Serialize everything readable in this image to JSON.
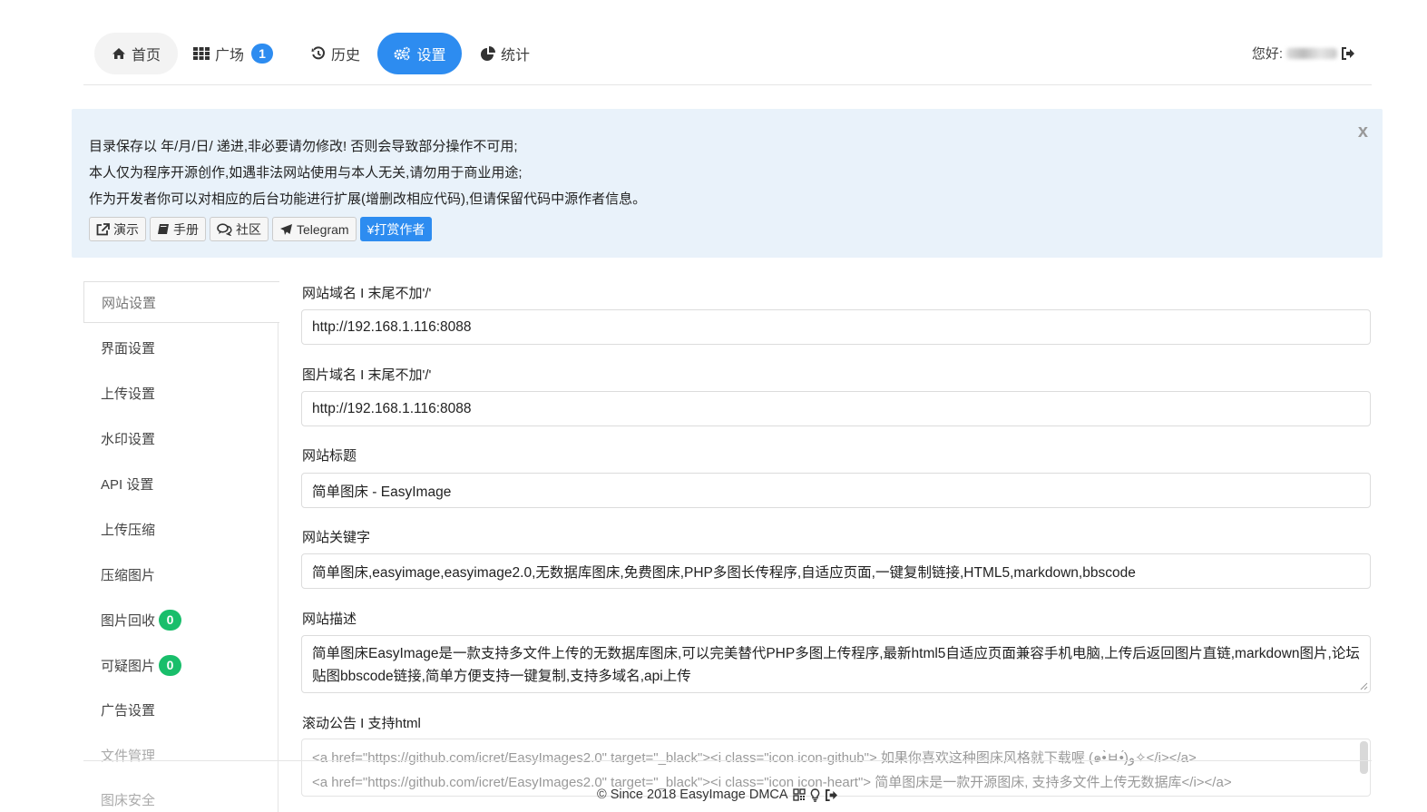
{
  "nav": {
    "home": "首页",
    "square": "广场",
    "square_badge": "1",
    "history": "历史",
    "settings": "设置",
    "stats": "统计",
    "greeting": "您好:"
  },
  "notice": {
    "line1": "目录保存以 年/月/日/ 递进,非必要请勿修改! 否则会导致部分操作不可用;",
    "line2": "本人仅为程序开源创作,如遇非法网站使用与本人无关,请勿用于商业用途;",
    "line3": "作为开发者你可以对相应的后台功能进行扩展(增删改相应代码),但请保留代码中源作者信息。",
    "close": "x",
    "buttons": {
      "demo": "演示",
      "manual": "手册",
      "community": "社区",
      "telegram": "Telegram",
      "donate": "¥打赏作者"
    }
  },
  "sidebar": {
    "items": [
      {
        "label": "网站设置"
      },
      {
        "label": "界面设置"
      },
      {
        "label": "上传设置"
      },
      {
        "label": "水印设置"
      },
      {
        "label": "API 设置"
      },
      {
        "label": "上传压缩"
      },
      {
        "label": "压缩图片"
      },
      {
        "label": "图片回收",
        "badge": "0"
      },
      {
        "label": "可疑图片",
        "badge": "0"
      },
      {
        "label": "广告设置"
      },
      {
        "label": "文件管理"
      },
      {
        "label": "图床安全"
      }
    ]
  },
  "form": {
    "domain_label": "网站域名 I 末尾不加'/'",
    "domain_value": "http://192.168.1.116:8088",
    "img_domain_label": "图片域名 I 末尾不加'/'",
    "img_domain_value": "http://192.168.1.116:8088",
    "title_label": "网站标题",
    "title_value": "简单图床 - EasyImage",
    "keywords_label": "网站关键字",
    "keywords_value": "简单图床,easyimage,easyimage2.0,无数据库图床,免费图床,PHP多图长传程序,自适应页面,一键复制链接,HTML5,markdown,bbscode",
    "desc_label": "网站描述",
    "desc_value": "简单图床EasyImage是一款支持多文件上传的无数据库图床,可以完美替代PHP多图上传程序,最新html5自适应页面兼容手机电脑,上传后返回图片直链,markdown图片,论坛贴图bbscode链接,简单方便支持一键复制,支持多域名,api上传",
    "notice_label": "滚动公告 I 支持html",
    "notice_line1": "<a href=\"https://github.com/icret/EasyImages2.0\" target=\"_black\"><i class=\"icon icon-github\"> 如果你喜欢这种图床风格就下载喔 (๑•̀ㅂ•́)و✧</i></a>",
    "notice_line2": "<a href=\"https://github.com/icret/EasyImages2.0\" target=\"_black\"><i class=\"icon icon-heart\"> 简单图床是一款开源图床, 支持多文件上传无数据库</i></a>"
  },
  "footer": {
    "text": "© Since 2018 EasyImage DMCA"
  },
  "colors": {
    "primary": "#2d8cf0",
    "success": "#19be6b",
    "notice_bg": "#e9f2fa"
  },
  "icons": [
    "home-icon",
    "grid-icon",
    "history-icon",
    "cogs-icon",
    "pie-chart-icon",
    "sign-out-icon",
    "external-link-icon",
    "book-icon",
    "comments-icon",
    "paper-plane-icon",
    "qrcode-icon",
    "lightbulb-icon"
  ]
}
